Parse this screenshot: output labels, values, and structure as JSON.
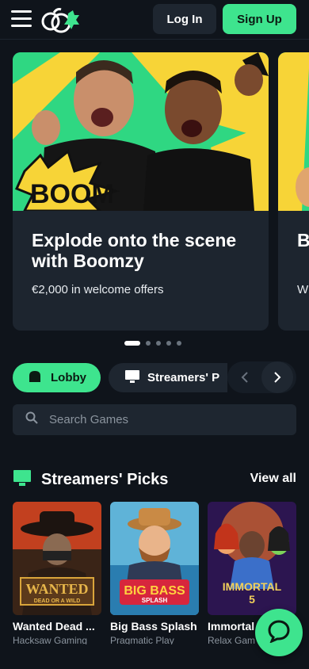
{
  "header": {
    "login_label": "Log In",
    "signup_label": "Sign Up",
    "icons": [
      "menu-icon",
      "boomzy-logo"
    ]
  },
  "carousel": {
    "slides": [
      {
        "title": "Explode onto the scene with Boomzy",
        "subtitle": "€2,000 in welcome offers",
        "image_text": "BOOM"
      },
      {
        "title": "B L",
        "subtitle": "Wi"
      }
    ],
    "active_index": 0,
    "dot_count": 5
  },
  "tabs": {
    "items": [
      {
        "label": "Lobby",
        "icon": "lobby-icon",
        "active": true
      },
      {
        "label": "Streamers' P",
        "icon": "monitor-icon",
        "active": false
      }
    ]
  },
  "search": {
    "placeholder": "Search Games"
  },
  "section": {
    "title": "Streamers' Picks",
    "view_all_label": "View all",
    "icon": "monitor-icon"
  },
  "games": [
    {
      "name": "Wanted Dead ...",
      "provider": "Hacksaw Gaming",
      "logo_line1": "WANTED",
      "logo_line2": "DEAD OR A WILD"
    },
    {
      "name": "Big Bass Splash",
      "provider": "Pragmatic Play",
      "logo_line1": "BIG BASS",
      "logo_line2": "SPLASH"
    },
    {
      "name": "Immortal",
      "provider": "Relax Gam",
      "logo_line1": "IMMORTAL",
      "logo_line2": "5"
    }
  ],
  "colors": {
    "accent": "#3ee48e",
    "background": "#0f141b",
    "surface": "#1e2630"
  }
}
